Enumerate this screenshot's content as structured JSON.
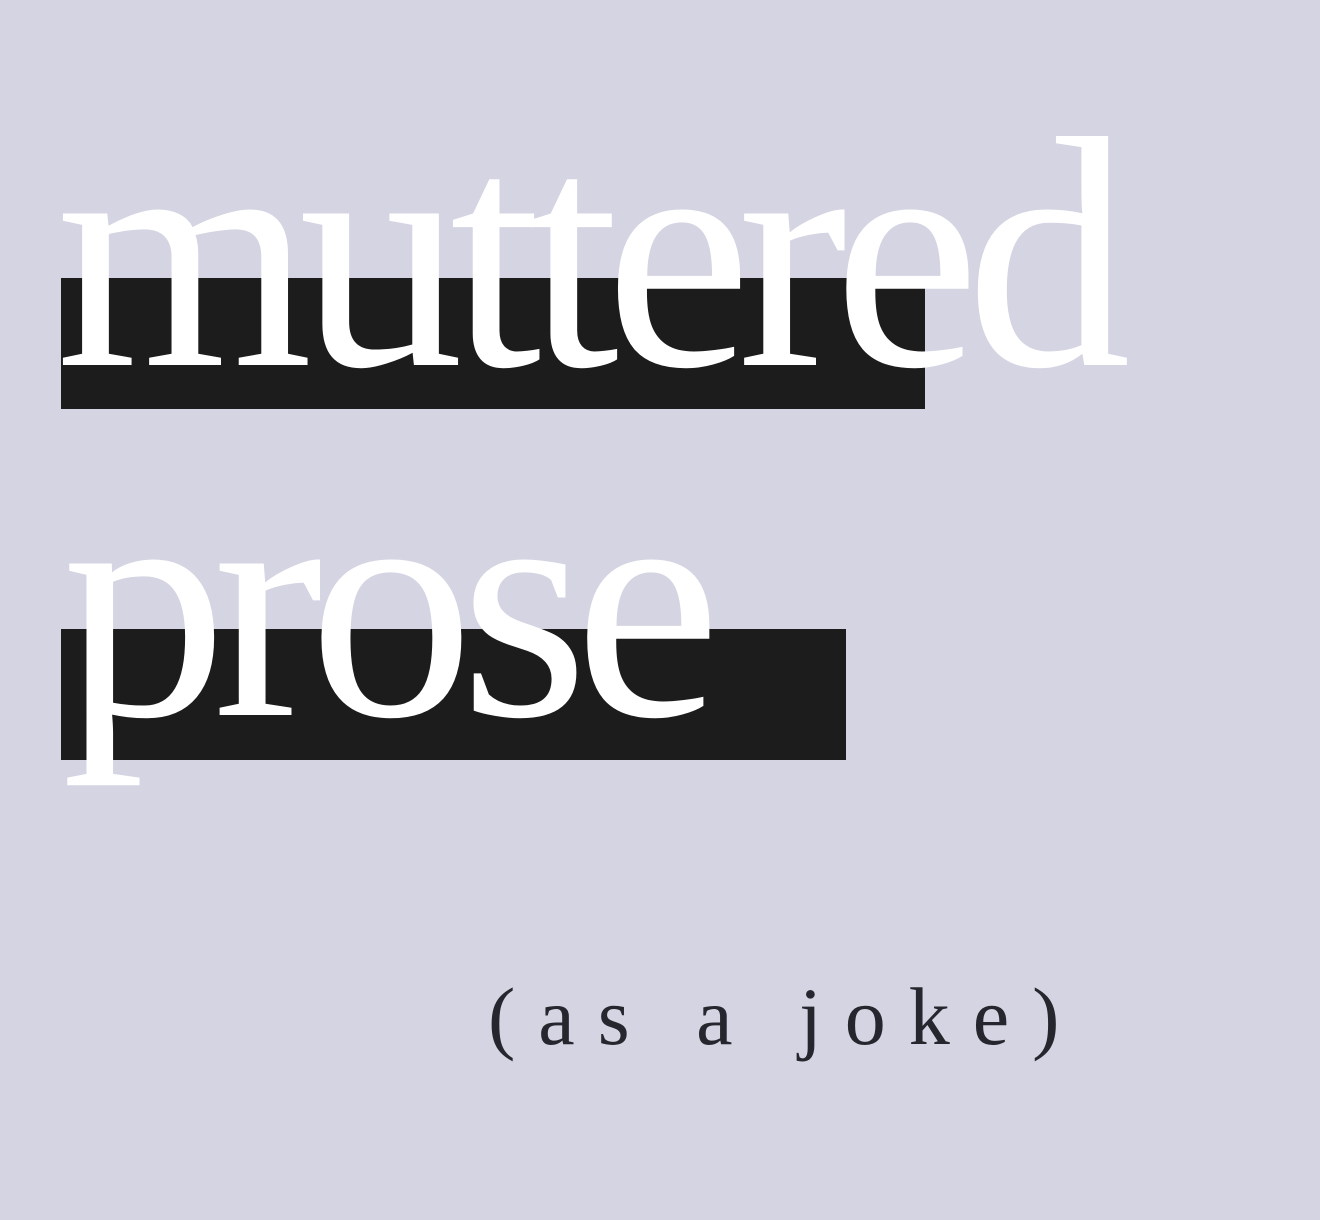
{
  "headline": {
    "line1": "muttered",
    "line2": "prose"
  },
  "tagline": "(as a joke)",
  "colors": {
    "background": "#d4d4e2",
    "bar": "#1c1c1c",
    "headline_text": "#ffffff",
    "tagline_text": "#26262e"
  }
}
